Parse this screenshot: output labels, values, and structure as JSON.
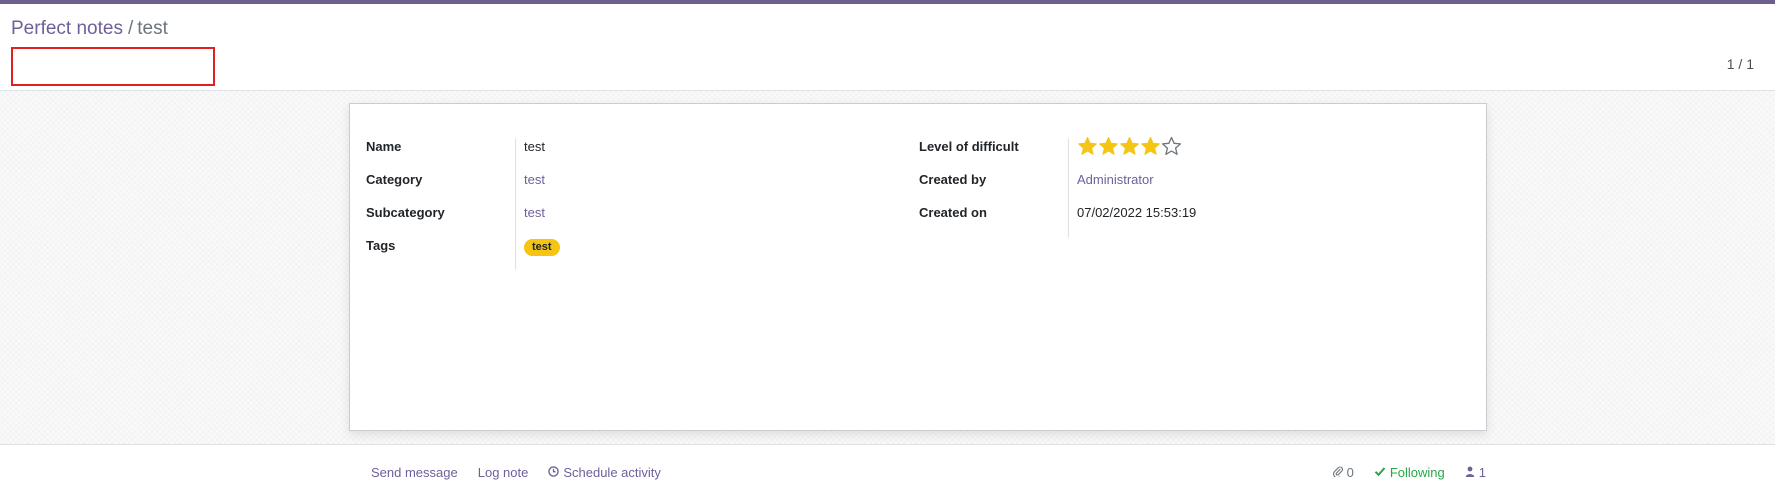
{
  "breadcrumb": {
    "parent": "Perfect notes",
    "separator": "/",
    "current": "test"
  },
  "pager": {
    "value": "1 / 1"
  },
  "form": {
    "left": [
      {
        "label": "Name",
        "value": "test"
      },
      {
        "label": "Category",
        "value": "test"
      },
      {
        "label": "Subcategory",
        "value": "test"
      },
      {
        "label": "Tags",
        "value": "test"
      }
    ],
    "right": {
      "difficulty_label": "Level of difficult",
      "difficulty_value": 4,
      "difficulty_max": 5,
      "created_by_label": "Created by",
      "created_by_value": "Administrator",
      "created_on_label": "Created on",
      "created_on_value": "07/02/2022 15:53:19"
    }
  },
  "chatter": {
    "send_message": "Send message",
    "log_note": "Log note",
    "schedule_activity": "Schedule activity",
    "attachments_count": "0",
    "following": "Following",
    "followers_count": "1"
  },
  "colors": {
    "accent": "#6f5f9b",
    "star_filled": "#f4c512",
    "tag_bg": "#f4c512",
    "following": "#28a745",
    "highlight_border": "#e02020"
  },
  "icons": {
    "attachment": "paperclip-icon",
    "following": "check-icon",
    "followers": "user-icon",
    "schedule": "clock-icon",
    "star": "star-icon"
  }
}
